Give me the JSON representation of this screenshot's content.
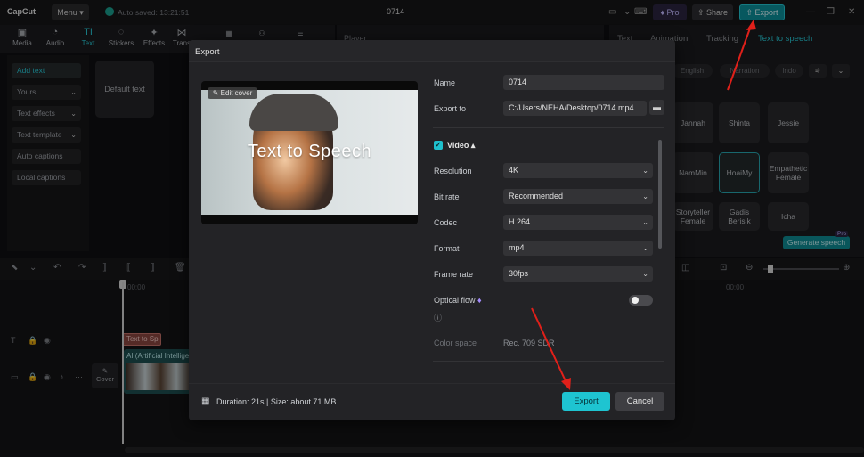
{
  "app": {
    "logo": "CapCut",
    "menu_label": "Menu",
    "autosave": "Auto saved: 13:21:51",
    "project_title": "0714",
    "pro_label": "Pro",
    "share_label": "Share",
    "export_label": "Export"
  },
  "toolbar": {
    "tools": [
      "Media",
      "Audio",
      "Text",
      "Stickers",
      "Effects",
      "Trans"
    ]
  },
  "left_panel": {
    "items": [
      "Add text",
      "Yours",
      "Text effects",
      "Text template",
      "Auto captions",
      "Local captions"
    ],
    "default_text": "Default text"
  },
  "player": {
    "label": "Player"
  },
  "right_panel": {
    "tabs": [
      "Text",
      "Animation",
      "Tracking",
      "Text to speech"
    ],
    "chips": [
      "English",
      "Narration",
      "Indo"
    ],
    "voices": [
      "Jannah",
      "Shinta",
      "Jessie",
      "NamMin",
      "HoaiMy",
      "Empathetic Female",
      "Storyteller Female",
      "Gadis Berisik",
      "Icha"
    ],
    "generate_label": "Generate speech",
    "pro_badge": "Pro"
  },
  "timeline": {
    "ruler_left": "00:00",
    "ruler_right": "00:00",
    "text_clip": "Text to Sp",
    "video_clip": "AI (Artificial Intellige",
    "cover_label": "Cover"
  },
  "dialog": {
    "title": "Export",
    "edit_cover": "Edit cover",
    "preview_text": "Text to Speech",
    "name_label": "Name",
    "name_value": "0714",
    "export_to_label": "Export to",
    "export_to_value": "C:/Users/NEHA/Desktop/0714.mp4",
    "video_section": "Video",
    "resolution_label": "Resolution",
    "resolution_value": "4K",
    "bitrate_label": "Bit rate",
    "bitrate_value": "Recommended",
    "codec_label": "Codec",
    "codec_value": "H.264",
    "format_label": "Format",
    "format_value": "mp4",
    "framerate_label": "Frame rate",
    "framerate_value": "30fps",
    "optical_flow_label": "Optical flow",
    "optical_flow_on": false,
    "color_space_label": "Color space",
    "color_space_value": "Rec. 709 SDR",
    "duration_text": "Duration: 21s | Size: about 71 MB",
    "export_button": "Export",
    "cancel_button": "Cancel"
  },
  "colors": {
    "accent": "#1ec4d1",
    "annotation_arrow": "#e0201a"
  }
}
